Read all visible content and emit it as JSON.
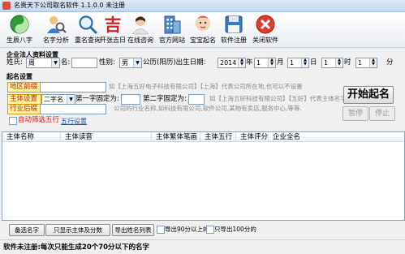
{
  "window": {
    "title": "名贵天下公司取名软件 1.1.0.0 未注册"
  },
  "toolbar": {
    "items": [
      {
        "label": "生辰八字"
      },
      {
        "label": "名字分析"
      },
      {
        "label": "重名查询"
      },
      {
        "label": "开张吉日"
      },
      {
        "label": "在线咨询"
      },
      {
        "label": "官方网站"
      },
      {
        "label": "宝宝起名"
      },
      {
        "label": "软件注册"
      },
      {
        "label": "关闭软件"
      }
    ]
  },
  "legal": {
    "section_title": "企业法人资料设置",
    "surname_label": "姓氏:",
    "surname_value": "周",
    "name_label": "名:",
    "name_value": "",
    "gender_label": "性别:",
    "gender_value": "男",
    "birth_label": "公历(阳历)出生日期:",
    "year_value": "2014",
    "year_unit": "年",
    "month_value": "1",
    "month_unit": "月",
    "day_value": "1",
    "day_unit": "日",
    "hour_value": "1",
    "hour_unit": "时",
    "minute_value": "1",
    "minute_unit": "分"
  },
  "naming": {
    "section_title": "起名设置",
    "region_tag": "地区前缀",
    "region_hint": "如【上海五好电子科技有限公司】【上海】代表公司所在地,也可以不设置",
    "subject_tag": "主体设置",
    "subject_select": "二字名",
    "first_fixed_label": "第一字固定为:",
    "second_fixed_label": "第二字固定为:",
    "subject_hint1": "如【上海五好科技有限公司】【五好】代表主体名字,字数为二字",
    "subject_hint2": "公司的行业名称,如科技有限公司,软件公司,某物有卖店,服务中心,等等.",
    "industry_tag": "行业后缀",
    "auto_filter_label": "自动筛选五行",
    "wuxing_link": "五行设置",
    "start_button": "开始起名",
    "pause_button": "暂停",
    "stop_button": "停止"
  },
  "table": {
    "columns": [
      "主体名称",
      "主体读音",
      "主体繁体笔画",
      "主体五行",
      "主体评分",
      "企业全名"
    ]
  },
  "bottom": {
    "backup_button": "备选名字",
    "only_subject_button": "只显示主体及分数",
    "export_button": "导出姓名列表",
    "export90_label": "导出90分以上的",
    "export100_label": "只导出100分的"
  },
  "status": {
    "text": "软件未注册:每次只能生成20个70分以下的名字"
  }
}
